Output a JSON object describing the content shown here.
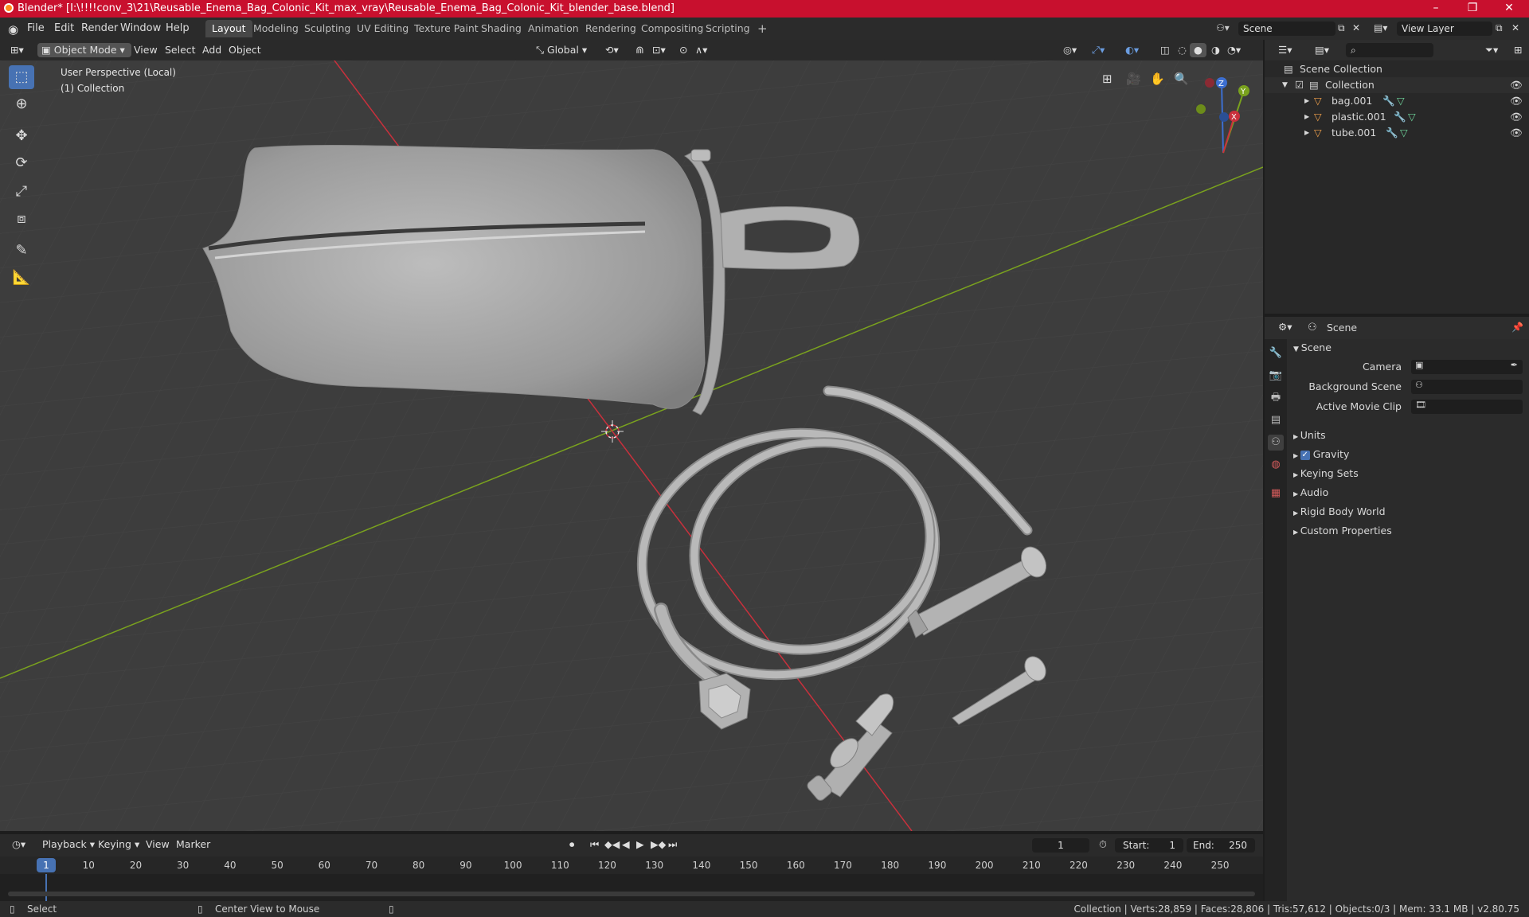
{
  "window": {
    "title": "Blender* [I:\\!!!!conv_3\\21\\Reusable_Enema_Bag_Colonic_Kit_max_vray\\Reusable_Enema_Bag_Colonic_Kit_blender_base.blend]",
    "minimize": "–",
    "maximize": "❐",
    "close": "✕"
  },
  "menu": {
    "file": "File",
    "edit": "Edit",
    "render": "Render",
    "window": "Window",
    "help": "Help"
  },
  "workspaces": [
    "Layout",
    "Modeling",
    "Sculpting",
    "UV Editing",
    "Texture Paint",
    "Shading",
    "Animation",
    "Rendering",
    "Compositing",
    "Scripting"
  ],
  "add_workspace": "+",
  "scene_field": "Scene",
  "view_layer_field": "View Layer",
  "viewport_header": {
    "mode": "Object Mode",
    "view": "View",
    "select": "Select",
    "add": "Add",
    "object": "Object",
    "orientation": "Global"
  },
  "viewport": {
    "perspective": "User Perspective (Local)",
    "collection": "(1) Collection",
    "gizmo": {
      "z": "Z",
      "y": "Y",
      "x": "X"
    }
  },
  "outliner": {
    "search_placeholder": "",
    "root": "Scene Collection",
    "collection": "Collection",
    "objects": [
      "bag.001",
      "plastic.001",
      "tube.001"
    ]
  },
  "properties": {
    "header": "Scene",
    "panel": "Scene",
    "camera_label": "Camera",
    "background_label": "Background Scene",
    "movieclip_label": "Active Movie Clip",
    "sections": [
      "Units",
      "Gravity",
      "Keying Sets",
      "Audio",
      "Rigid Body World",
      "Custom Properties"
    ],
    "gravity_checked": true
  },
  "timeline": {
    "playback": "Playback",
    "keying": "Keying",
    "view": "View",
    "marker": "Marker",
    "current_frame": "1",
    "start_label": "Start:",
    "start": "1",
    "end_label": "End:",
    "end": "250",
    "ticks": [
      "1",
      "10",
      "20",
      "30",
      "40",
      "50",
      "60",
      "70",
      "80",
      "90",
      "100",
      "110",
      "120",
      "130",
      "140",
      "150",
      "160",
      "170",
      "180",
      "190",
      "200",
      "210",
      "220",
      "230",
      "240",
      "250"
    ]
  },
  "status": {
    "select": "Select",
    "center": "Center View to Mouse",
    "stats": "Collection | Verts:28,859 | Faces:28,806 | Tris:57,612 | Objects:0/3 | Mem: 33.1 MB | v2.80.75"
  },
  "colors": {
    "accent": "#4772b3",
    "titlebar": "#c8102e",
    "x_axis": "#c9303c",
    "y_axis": "#7aa21e"
  }
}
